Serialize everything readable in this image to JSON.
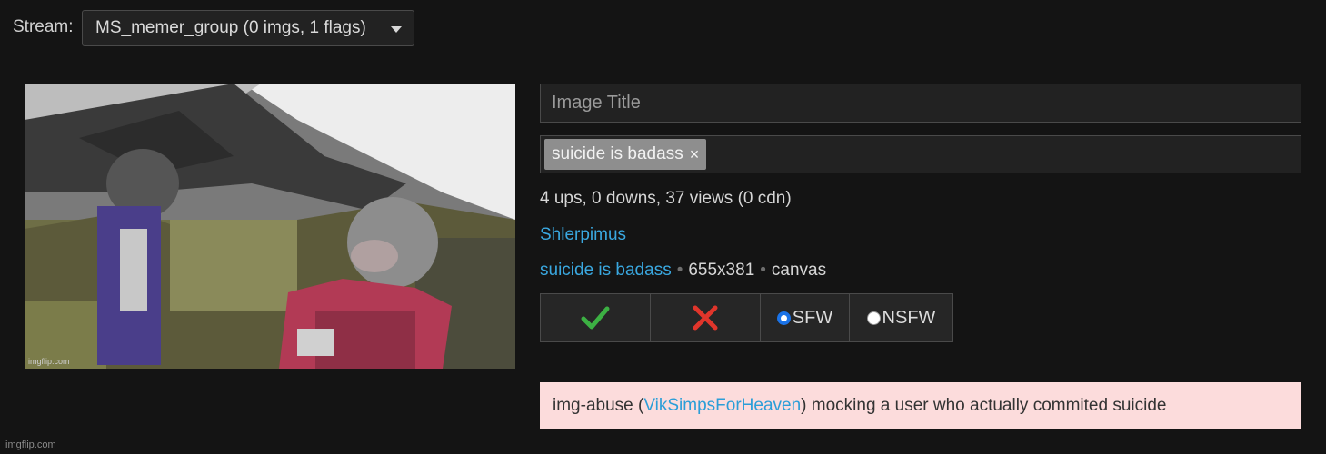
{
  "stream": {
    "label": "Stream:",
    "selected": "MS_memer_group (0 imgs, 1 flags)"
  },
  "preview": {
    "watermark": "imgflip.com"
  },
  "form": {
    "title_placeholder": "Image Title",
    "tags": [
      {
        "label": "suicide is badass",
        "remove": "×"
      }
    ]
  },
  "stats": "4 ups, 0 downs, 37 views (0 cdn)",
  "author": "Shlerpimus",
  "meta": {
    "tag_link": "suicide is badass",
    "dimensions": "655x381",
    "type": "canvas",
    "separator": "•"
  },
  "actions": {
    "approve_icon": "check-icon",
    "reject_icon": "cross-icon",
    "sfw_label": "SFW",
    "nsfw_label": "NSFW",
    "selected": "SFW"
  },
  "flag": {
    "prefix": "img-abuse (",
    "user": "VikSimpsForHeaven",
    "suffix": ") mocking a user who actually commited suicide"
  },
  "footer_watermark": "imgflip.com",
  "colors": {
    "background": "#141414",
    "link": "#3aa8e0",
    "approve": "#3cb043",
    "reject": "#e0352b",
    "flag_bg": "#fcdcdc"
  }
}
